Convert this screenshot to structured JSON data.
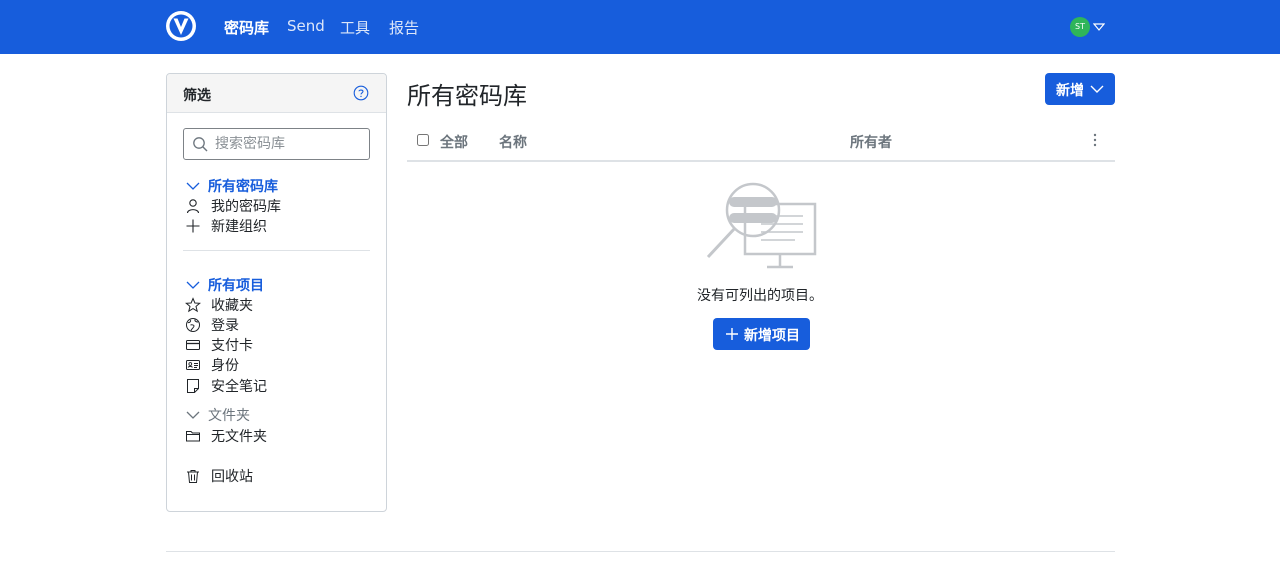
{
  "nav": {
    "links": [
      "密码库",
      "Send",
      "工具",
      "报告"
    ],
    "avatar_initials": "ST"
  },
  "sidebar": {
    "title": "筛选",
    "search_placeholder": "搜索密码库",
    "vaults": {
      "header": "所有密码库",
      "items": [
        "我的密码库",
        "新建组织"
      ]
    },
    "items_group": {
      "header": "所有项目",
      "items": [
        "收藏夹",
        "登录",
        "支付卡",
        "身份",
        "安全笔记"
      ]
    },
    "folders": {
      "header": "文件夹",
      "items": [
        "无文件夹"
      ]
    },
    "trash": "回收站"
  },
  "main": {
    "title": "所有密码库",
    "new_button": "新增",
    "columns": [
      "全部",
      "名称",
      "所有者"
    ],
    "empty_text": "没有可列出的项目。",
    "add_item_button": "新增项目"
  },
  "colors": {
    "brand": "#175ddc",
    "avatar": "#2fb55a"
  }
}
